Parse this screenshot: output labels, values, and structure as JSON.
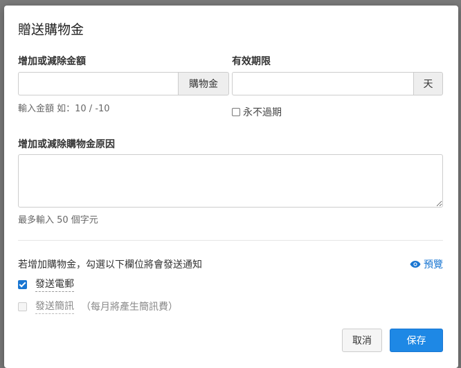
{
  "dialog": {
    "title": "贈送購物金",
    "amount": {
      "label": "增加或減除金額",
      "addon": "購物金",
      "value": "",
      "help": "輸入金額 如：10 / -10"
    },
    "expiry": {
      "label": "有效期限",
      "addon": "天",
      "value": "",
      "never_expire_label": "永不過期",
      "never_expire_checked": false
    },
    "reason": {
      "label": "增加或減除購物金原因",
      "value": "",
      "help": "最多輸入 50 個字元"
    },
    "notify": {
      "text": "若增加購物金，勾選以下欄位將會發送通知",
      "preview_label": "預覽",
      "email": {
        "label": "發送電郵",
        "checked": true
      },
      "sms": {
        "label": "發送簡訊",
        "note": "（每月將產生簡訊費）",
        "checked": false,
        "disabled": true
      }
    },
    "buttons": {
      "cancel": "取消",
      "save": "保存"
    }
  },
  "colors": {
    "primary": "#1e88e5",
    "link": "#1976d2"
  }
}
